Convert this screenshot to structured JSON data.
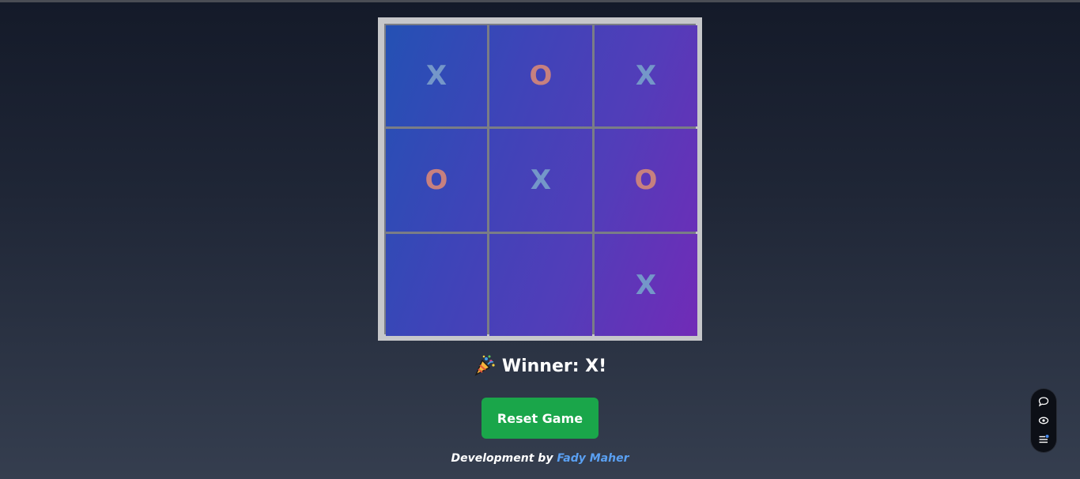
{
  "board": {
    "cells": [
      "X",
      "O",
      "X",
      "O",
      "X",
      "O",
      "",
      "",
      "X"
    ]
  },
  "status": {
    "icon": "party-popper-icon",
    "text": "Winner: X!"
  },
  "reset": {
    "label": "Reset Game"
  },
  "credit": {
    "prefix": "Development by",
    "author": "Fady Maher"
  },
  "toolbar": {
    "icons": [
      "comment-icon",
      "eye-icon",
      "list-icon"
    ]
  },
  "colors": {
    "x_mark": "#7497c9",
    "o_mark": "#c7807f",
    "reset_button": "#1aa64a",
    "author_link": "#5aa0f2"
  }
}
